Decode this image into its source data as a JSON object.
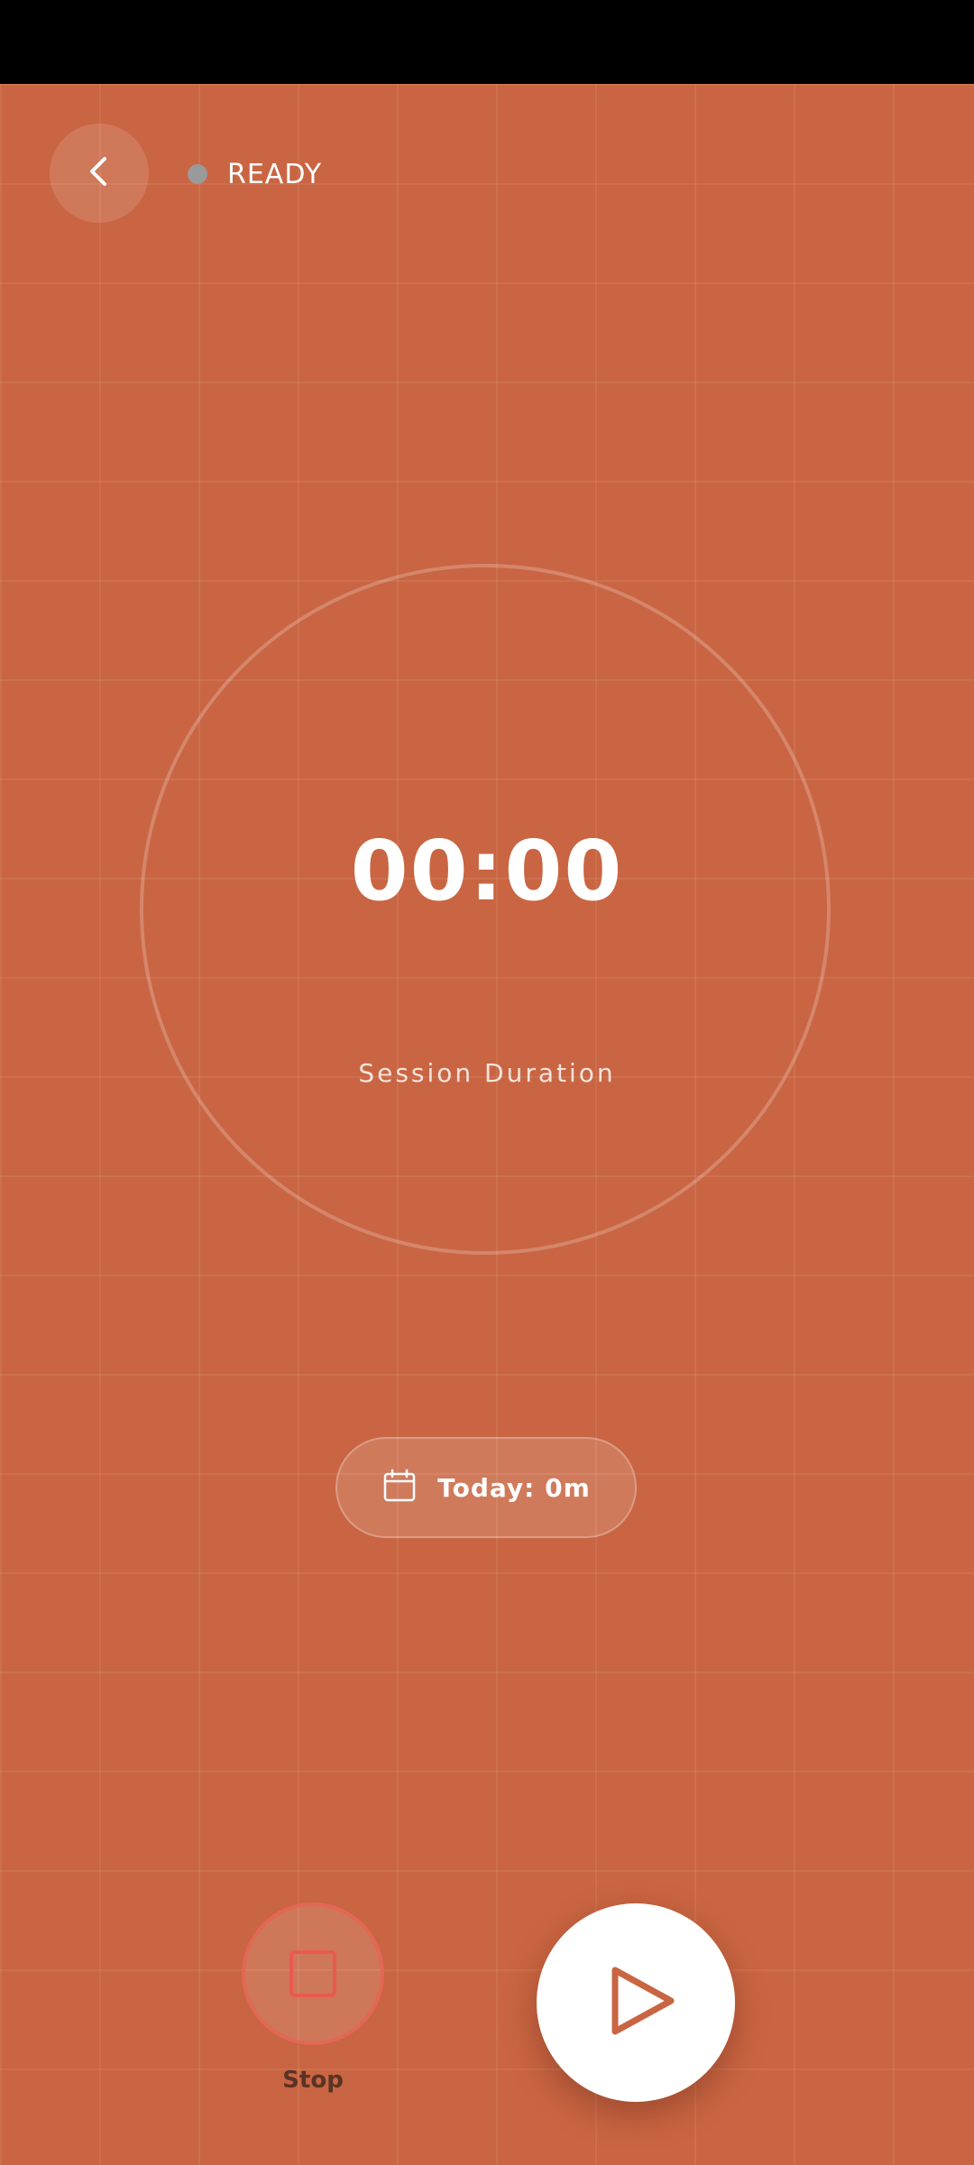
{
  "header": {
    "status": "READY"
  },
  "timer": {
    "value": "00:00",
    "caption": "Session Duration"
  },
  "today": {
    "label": "Today: 0m"
  },
  "controls": {
    "stop_label": "Stop"
  },
  "colors": {
    "background": "#c96542",
    "status_dot": "#9a9a9a",
    "stop_accent": "#e85a4f",
    "play_bg": "#ffffff",
    "play_icon": "#c96542"
  },
  "icons": {
    "back": "chevron-left-icon",
    "calendar": "calendar-icon",
    "stop": "stop-icon",
    "play": "play-icon"
  }
}
